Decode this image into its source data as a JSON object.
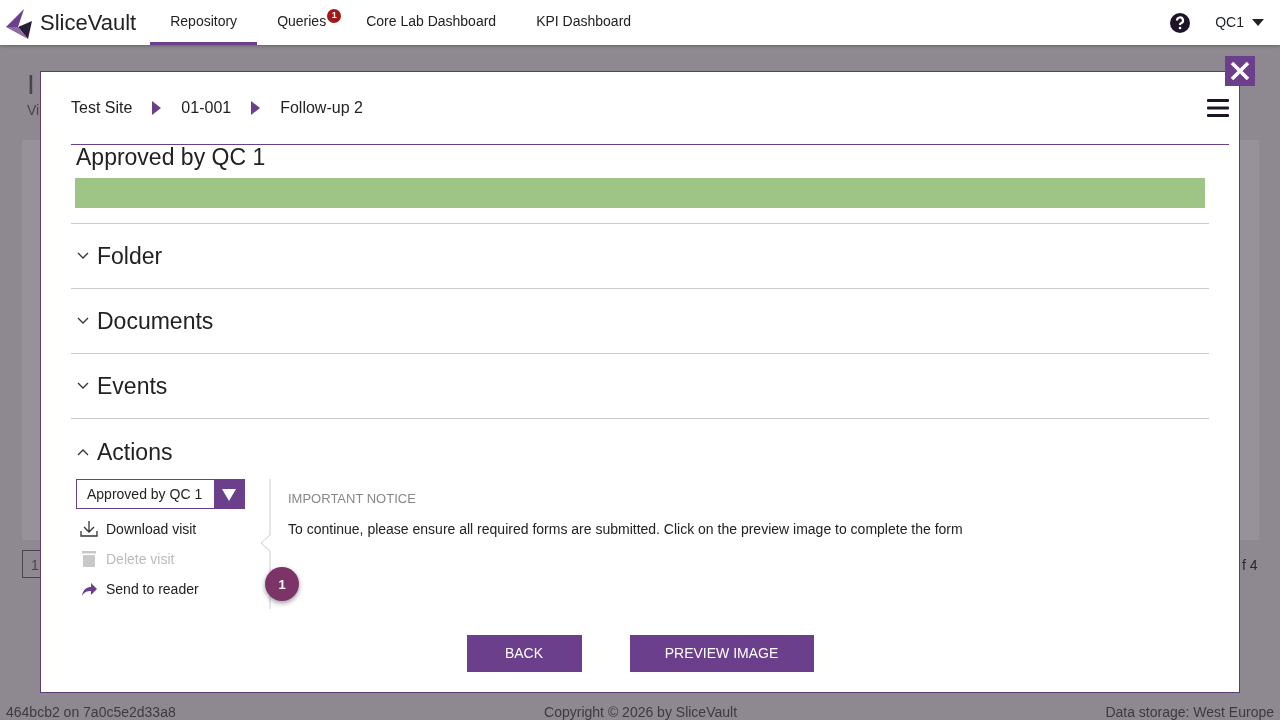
{
  "navbar": {
    "brand": "SliceVault",
    "tabs": [
      {
        "label": "Repository",
        "selected": true
      },
      {
        "label": "Queries",
        "selected": false,
        "badge": "1"
      },
      {
        "label": "Core Lab Dashboard",
        "selected": false
      },
      {
        "label": "KPI Dashboard",
        "selected": false
      }
    ],
    "user": "QC1"
  },
  "background": {
    "heading": "I",
    "subheading": "Vi",
    "pager_page": "1",
    "pager_total": "f 4"
  },
  "footer": {
    "version": "464bcb2 on 7a0c5e2d33a8",
    "copyright": "Copyright © 2026 by SliceVault",
    "storage": "Data storage: West Europe"
  },
  "modal": {
    "breadcrumb": [
      "Test Site",
      "01-001",
      "Follow-up 2"
    ],
    "status": {
      "label": "Approved by QC 1",
      "level": 1
    },
    "sections": [
      {
        "title": "Folder",
        "expanded": false
      },
      {
        "title": "Documents",
        "expanded": false
      },
      {
        "title": "Events",
        "expanded": false
      },
      {
        "title": "Actions",
        "expanded": true
      }
    ],
    "actions": {
      "select_value": "Approved by QC 1",
      "items": [
        {
          "kind": "download",
          "label": "Download visit",
          "disabled": false
        },
        {
          "kind": "delete",
          "label": "Delete visit",
          "disabled": true
        },
        {
          "kind": "send",
          "label": "Send to reader",
          "disabled": false
        }
      ],
      "notice_title": "IMPORTANT NOTICE",
      "notice_text": "To continue, please ensure all required forms are submitted. Click on the preview image to complete the form",
      "step": "1"
    },
    "buttons": [
      "BACK",
      "PREVIEW IMAGE"
    ]
  }
}
